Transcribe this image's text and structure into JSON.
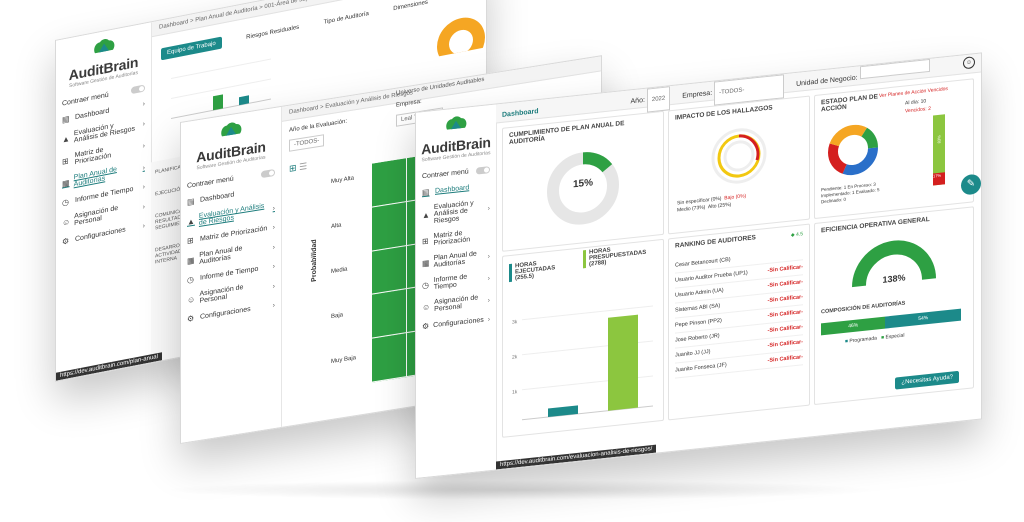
{
  "brand": {
    "name": "AuditBrain",
    "tagline": "Software Gestión de Auditorías"
  },
  "colors": {
    "teal": "#1c8a8a",
    "green": "#2ea043",
    "lime": "#8cc63f",
    "red": "#d41f1f",
    "orange": "#f5a623",
    "blue": "#2a6fc9"
  },
  "winA": {
    "breadcrumb": "Dashboard > Plan Anual de Auditoría > 001-Área de soporte y apoyo",
    "tab_equipo": "Equipo de Trabajo",
    "col_dimensiones": "Dimensiones",
    "rango_residuales": "Riesgos Residuales",
    "tipo_auditoria": "Tipo de Auditoría",
    "nav": [
      "Contraer menú",
      "Dashboard",
      "Evaluación y Análisis de Riesgos",
      "Matriz de Priorización",
      "Plan Anual de Auditorías",
      "Informe de Tiempo",
      "Asignación de Personal",
      "Configuraciones"
    ],
    "list_items": [
      "PLANIFICACIÓN",
      "EJECUCIÓN",
      "COMUNICACIÓN DE RESULTADOS Y SEGUIMIENTO",
      "DESARROLLO DE LA ACTIVIDAD DE AUDITORÍA INTERNA"
    ],
    "status_url": "https://dev.auditbrain.com/plan-anual"
  },
  "winB": {
    "breadcrumb": "Dashboard > Evaluación y Análisis de Riesgos",
    "anio_label": "Año de la Evaluación:",
    "anio_value": "-TODOS-",
    "empresa_label": "Empresa:",
    "empresa_value": "Leal Tele S.A.",
    "universo": "Universo de Unidades Auditables",
    "axis_prob": "Probabilidad",
    "rows": [
      "Muy Alta",
      "Alta",
      "Media",
      "Baja",
      "Muy Baja"
    ],
    "nav": [
      "Contraer menú",
      "Dashboard",
      "Evaluación y Análisis de Riesgos",
      "Matriz de Priorización",
      "Plan Anual de Auditorías",
      "Informe de Tiempo",
      "Asignación de Personal",
      "Configuraciones"
    ]
  },
  "winC": {
    "header_title": "Dashboard",
    "anio_label": "Año:",
    "anio_value": "2022",
    "empresa_label": "Empresa:",
    "empresa_value": "-TODOS-",
    "unidad_label": "Unidad de Negocio:",
    "unidad_value": "",
    "nav": [
      "Contraer menú",
      "Dashboard",
      "Evaluación y Análisis de Riesgos",
      "Matriz de Priorización",
      "Plan Anual de Auditorías",
      "Informe de Tiempo",
      "Asignación de Personal",
      "Configuraciones"
    ],
    "cumplimiento": {
      "title": "CUMPLIMIENTO DE PLAN ANUAL DE AUDITORÍA",
      "percent": 15,
      "label": "15%"
    },
    "impacto": {
      "title": "IMPACTO DE LOS HALLAZGOS",
      "legend": [
        "Sin especificar (0%)",
        "Bajo (0%)",
        "Medio (73%)",
        "Alto (25%)"
      ]
    },
    "estado": {
      "title": "ESTADO PLAN DE ACCIÓN",
      "link": "Ver Planes de Acción Vencidos",
      "al_dia": "Al día: 10",
      "vencidos": "Vencidos: 2",
      "legend": [
        "Pendiente: 1",
        "En Proceso: 3",
        "Implementado: 1",
        "Evaluado: 5",
        "Declinado: 0"
      ],
      "bar_value": "83%",
      "bar_low": "17%"
    },
    "horas": {
      "ejecutadas_label": "HORAS EJECUTADAS (255.5)",
      "presupuestadas_label": "HORAS PRESUPUESTADAS (2788)",
      "ejecutadas": 255.5,
      "presupuestadas": 2788,
      "ticks": [
        "3k",
        "2k",
        "1k"
      ]
    },
    "ranking": {
      "title": "RANKING DE AUDITORES",
      "score": "4.5",
      "rows": [
        {
          "name": "Cesar Betancourt (CB)",
          "value": ""
        },
        {
          "name": "Usuario Auditor Prueba (UP1)",
          "value": "-Sin Calificar-"
        },
        {
          "name": "Usuario Admin (UA)",
          "value": "-Sin Calificar-"
        },
        {
          "name": "Sistemas ABI (SA)",
          "value": "-Sin Calificar-"
        },
        {
          "name": "Pepe Pinson (PP2)",
          "value": "-Sin Calificar-"
        },
        {
          "name": "Jose Roberto (JR)",
          "value": "-Sin Calificar-"
        },
        {
          "name": "Juanito JJ (JJ)",
          "value": "-Sin Calificar-"
        },
        {
          "name": "Juanito Fonseca (JF)",
          "value": "-Sin Calificar-"
        }
      ]
    },
    "eficiencia": {
      "title": "EFICIENCIA OPERATIVA GENERAL",
      "label": "138%",
      "percent": 138
    },
    "composicion": {
      "title": "COMPOSICIÓN DE AUDITORÍAS",
      "left": "46%",
      "right": "54%",
      "legend_a": "Programada",
      "legend_b": "Especial"
    },
    "help_button": "¿Necesitas Ayuda?",
    "status_url": "https://dev.auditbrain.com/evaluacion-analisis-de-riesgos/"
  }
}
